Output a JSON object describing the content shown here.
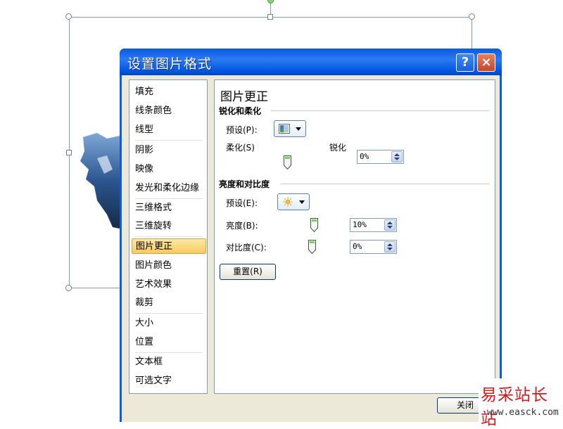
{
  "dialog": {
    "title": "设置图片格式",
    "help_label": "?",
    "close_label": "×"
  },
  "nav": {
    "items": [
      {
        "label": "填充"
      },
      {
        "label": "线条颜色"
      },
      {
        "label": "线型"
      },
      {
        "label": "阴影"
      },
      {
        "label": "映像"
      },
      {
        "label": "发光和柔化边缘"
      },
      {
        "label": "三维格式"
      },
      {
        "label": "三维旋转"
      },
      {
        "label": "图片更正",
        "selected": true
      },
      {
        "label": "图片颜色"
      },
      {
        "label": "艺术效果"
      },
      {
        "label": "裁剪"
      },
      {
        "label": "大小"
      },
      {
        "label": "位置"
      },
      {
        "label": "文本框"
      },
      {
        "label": "可选文字"
      }
    ]
  },
  "panel": {
    "title": "图片更正",
    "sharpen": {
      "heading": "锐化和柔化",
      "preset_label": "预设(P):",
      "preset_icon": "sharpen-preset-icon",
      "soften_label": "柔化(S)",
      "sharpen_label": "锐化",
      "value": "0%",
      "slider_percent": 50
    },
    "brightness_contrast": {
      "heading": "亮度和对比度",
      "preset_label": "预设(E):",
      "preset_icon": "sun-icon",
      "brightness_label": "亮度(B):",
      "brightness_value": "10%",
      "brightness_percent": 55,
      "contrast_label": "对比度(C):",
      "contrast_value": "0%",
      "contrast_percent": 50
    },
    "reset_label": "重置(R)"
  },
  "footer": {
    "close_label": "关闭"
  },
  "watermark": {
    "main": "易采站长站",
    "sub": "www.easck.com"
  },
  "colors": {
    "title_blue": "#0054e3",
    "dialog_face": "#ece9d8",
    "selection_gold": "#f9c95c",
    "close_red": "#c7452a",
    "watermark_red": "#d21a1a"
  }
}
